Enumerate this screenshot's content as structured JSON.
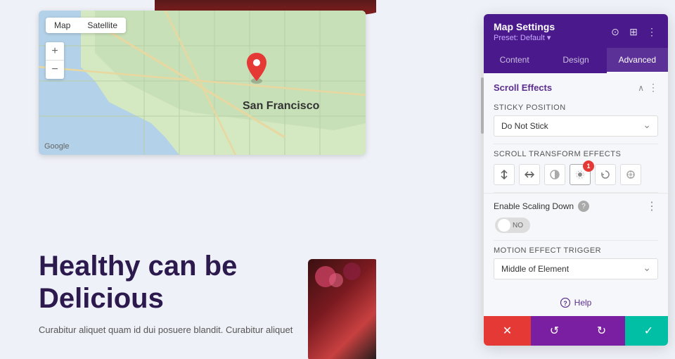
{
  "panel": {
    "title": "Map Settings",
    "preset": "Preset: Default ▾",
    "tabs": [
      {
        "label": "Content",
        "active": false
      },
      {
        "label": "Design",
        "active": false
      },
      {
        "label": "Advanced",
        "active": true
      }
    ],
    "header_icons": [
      "⊙",
      "⊞",
      "⋮"
    ]
  },
  "scroll_effects": {
    "section_title": "Scroll Effects",
    "sticky_position_label": "Sticky Position",
    "sticky_position_value": "Do Not Stick",
    "transform_effects_label": "Scroll Transform Effects",
    "transform_icons": [
      {
        "name": "vertical-scroll-icon",
        "symbol": "↕",
        "badge": null
      },
      {
        "name": "horizontal-scroll-icon",
        "symbol": "⇄",
        "badge": null
      },
      {
        "name": "opacity-icon",
        "symbol": "◑",
        "badge": null
      },
      {
        "name": "blur-icon",
        "symbol": "✦",
        "badge": "1"
      },
      {
        "name": "rotate-icon",
        "symbol": "↻",
        "badge": null
      },
      {
        "name": "color-icon",
        "symbol": "◈",
        "badge": null
      }
    ],
    "enable_scaling_label": "Enable Scaling Down",
    "toggle_text": "NO",
    "motion_trigger_label": "Motion Effect Trigger",
    "motion_trigger_value": "Middle of Element"
  },
  "bottom": {
    "help_label": "Help",
    "actions": {
      "cancel": "✕",
      "undo": "↺",
      "redo": "↻",
      "save": "✓"
    }
  },
  "map": {
    "tab_map": "Map",
    "tab_satellite": "Satellite",
    "city_label": "San Francisco",
    "google_label": "Google"
  },
  "page": {
    "headline_line1": "Healthy can be",
    "headline_line2": "Delicious",
    "body_text": "Curabitur aliquet quam id dui posuere blandit. Curabitur aliquet"
  }
}
